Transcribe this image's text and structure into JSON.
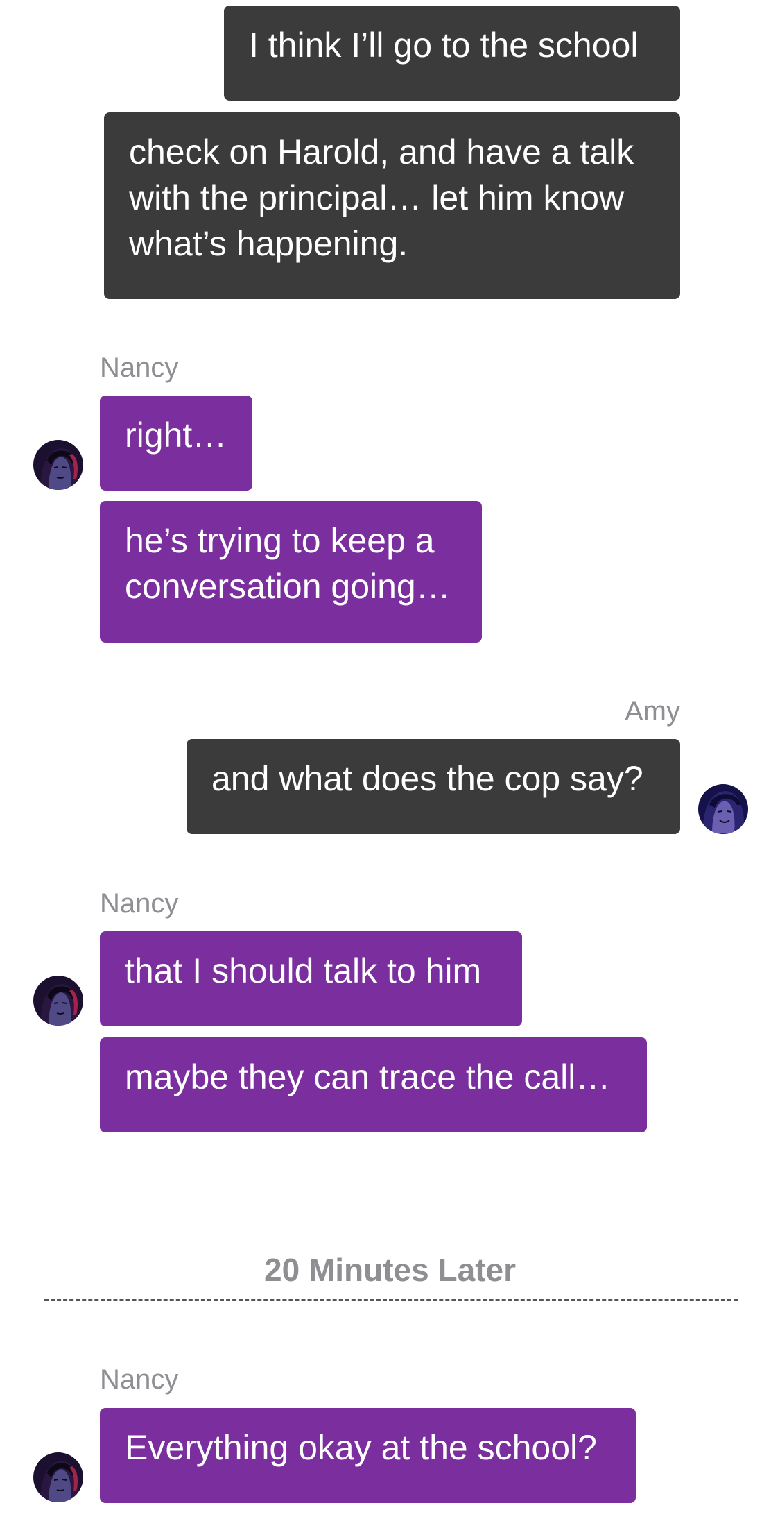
{
  "messages": [
    {
      "sender": "",
      "text": "I think I’ll go to the school",
      "direction": "outgoing"
    },
    {
      "sender": "",
      "text": "check on Harold, and have a talk\nwith the principal… let him know\nwhat’s happening.",
      "direction": "outgoing"
    },
    {
      "sender": "Nancy",
      "text": "right…",
      "direction": "incoming"
    },
    {
      "sender": "Nancy",
      "text": "he’s trying to keep a\nconversation going…",
      "direction": "incoming"
    },
    {
      "sender": "Amy",
      "text": "and what does the cop say?",
      "direction": "outgoing"
    },
    {
      "sender": "Nancy",
      "text": "that I should talk to him",
      "direction": "incoming"
    },
    {
      "sender": "Nancy",
      "text": "maybe they can trace the call…",
      "direction": "incoming"
    },
    {
      "sender": "Nancy",
      "text": "Everything okay at the school?",
      "direction": "incoming"
    }
  ],
  "labels": {
    "nancy_1": "Nancy",
    "amy_1": "Amy",
    "nancy_2": "Nancy",
    "nancy_3": "Nancy"
  },
  "divider": {
    "text": "20 Minutes Later"
  },
  "avatars": {
    "nancy_icon": "nancy-avatar-icon",
    "amy_icon": "amy-avatar-icon"
  },
  "colors": {
    "outgoing_bubble": "#3b3b3b",
    "incoming_bubble": "#7b2f9e",
    "sender_label": "#8e8e93",
    "background": "#ffffff"
  }
}
